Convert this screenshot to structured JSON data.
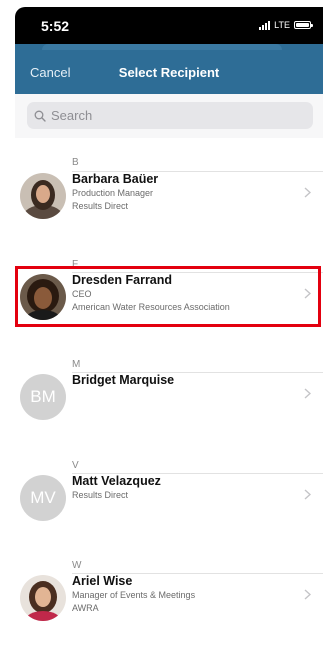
{
  "status": {
    "time": "5:52",
    "network": "LTE"
  },
  "nav": {
    "cancel_label": "Cancel",
    "title": "Select Recipient"
  },
  "search": {
    "placeholder": "Search",
    "value": ""
  },
  "sections": [
    {
      "letter": "B",
      "contacts": [
        {
          "name": "Barbara Baüer",
          "line1": "Production Manager",
          "line2": "Results Direct",
          "avatar": "photo"
        }
      ]
    },
    {
      "letter": "F",
      "contacts": [
        {
          "name": "Dresden Farrand",
          "line1": "CEO",
          "line2": "American Water Resources Association",
          "avatar": "photo"
        }
      ]
    },
    {
      "letter": "M",
      "contacts": [
        {
          "name": "Bridget Marquise",
          "initials": "BM"
        }
      ]
    },
    {
      "letter": "V",
      "contacts": [
        {
          "name": "Matt Velazquez",
          "line1": "Results Direct",
          "initials": "MV"
        }
      ]
    },
    {
      "letter": "W",
      "contacts": [
        {
          "name": "Ariel Wise",
          "line1": "Manager of Events & Meetings",
          "line2": "AWRA",
          "avatar": "photo"
        }
      ]
    }
  ],
  "colors": {
    "nav": "#2e6d96",
    "highlight": "#e3000f",
    "initials_bg": "#d2d2d2"
  },
  "icons": {
    "search": "magnifier-icon",
    "row_action": "chevron-right-icon",
    "signal": "cellular-signal-icon",
    "battery": "battery-icon"
  }
}
